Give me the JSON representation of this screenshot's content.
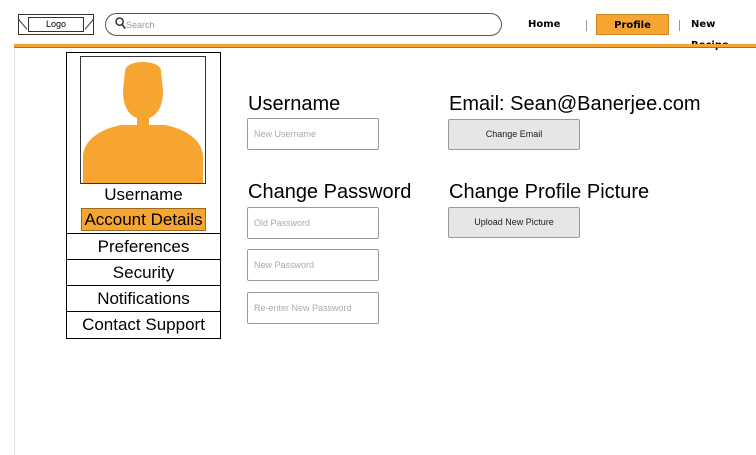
{
  "header": {
    "logo_label": "Logo",
    "search_placeholder": "Search",
    "nav": {
      "home": "Home",
      "profile": "Profile",
      "new_recipe": "New Recipe"
    },
    "accent_color": "#f7a531"
  },
  "sidebar": {
    "username": "Username",
    "items": [
      {
        "label": "Account Details",
        "active": true
      },
      {
        "label": "Preferences"
      },
      {
        "label": "Security"
      },
      {
        "label": "Notifications"
      },
      {
        "label": "Contact Support"
      }
    ],
    "avatar_color": "#f7a531"
  },
  "main": {
    "username_heading": "Username",
    "username_placeholder": "New Username",
    "email_heading": "Email: Sean@Banerjee.com",
    "change_email_label": "Change Email",
    "password_heading": "Change Password",
    "old_password_placeholder": "Old Password",
    "new_password_placeholder": "New Password",
    "reenter_password_placeholder": "Re-enter New Password",
    "picture_heading": "Change Profile Picture",
    "upload_picture_label": "Upload New Picture"
  }
}
